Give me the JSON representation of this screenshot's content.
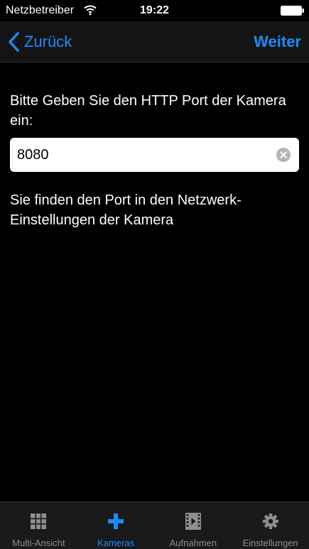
{
  "status_bar": {
    "carrier": "Netzbetreiber",
    "time": "19:22"
  },
  "nav": {
    "back_label": "Zurück",
    "next_label": "Weiter"
  },
  "form": {
    "prompt": "Bitte Geben Sie den HTTP Port der Kamera ein:",
    "port_value": "8080",
    "hint": "Sie finden den Port in den Netzwerk-Einstellungen der Kamera"
  },
  "tabs": [
    {
      "label": "Multi-Ansicht",
      "icon": "grid-icon",
      "active": false
    },
    {
      "label": "Kameras",
      "icon": "plus-icon",
      "active": true
    },
    {
      "label": "Aufnahmen",
      "icon": "film-icon",
      "active": false
    },
    {
      "label": "Einstellungen",
      "icon": "gear-icon",
      "active": false
    }
  ],
  "colors": {
    "accent": "#1a8cff",
    "background": "#000000",
    "inactive_tab": "#8e8e93"
  }
}
